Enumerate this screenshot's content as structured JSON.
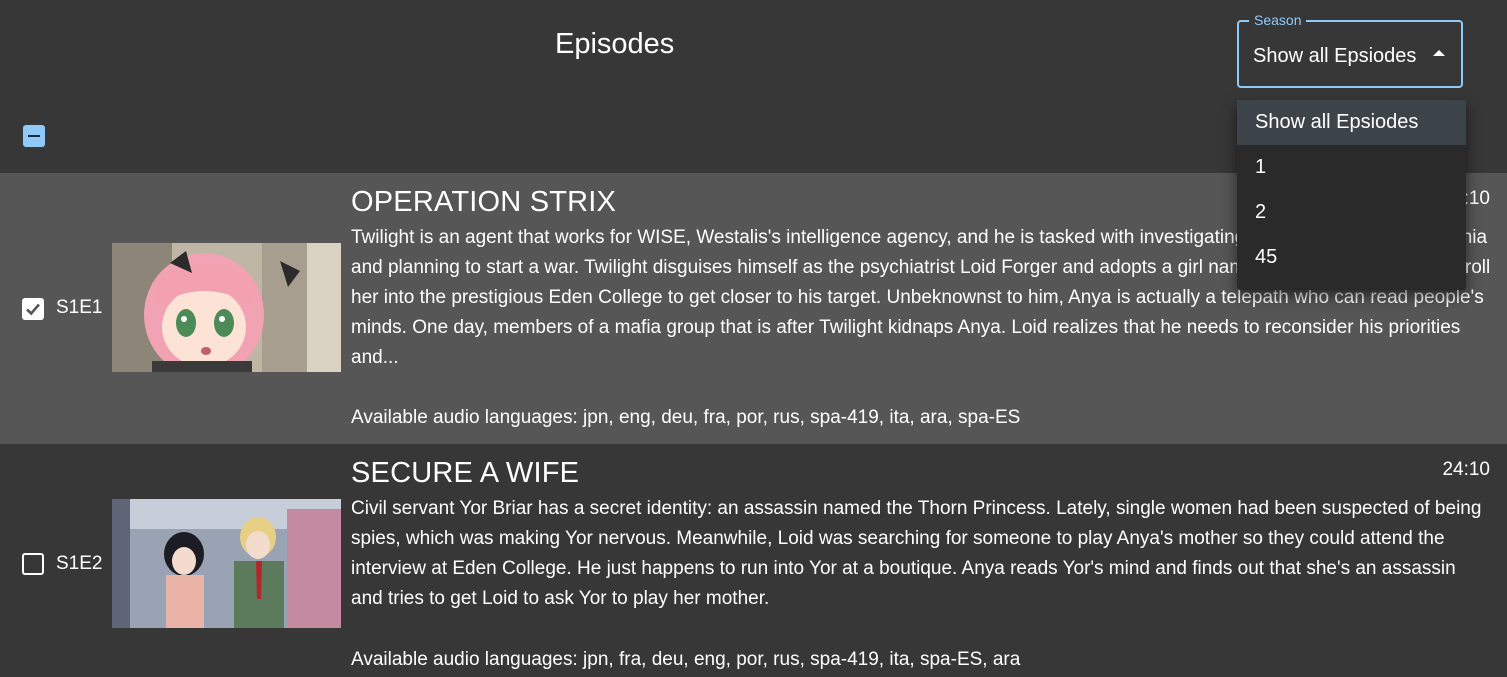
{
  "header": {
    "title": "Episodes"
  },
  "season": {
    "label": "Season",
    "selected": "Show all Epsiodes",
    "options": [
      "Show all Epsiodes",
      "1",
      "2",
      "45"
    ]
  },
  "colors": {
    "accent": "#90caf9",
    "row_selected_bg": "#565656",
    "page_bg": "#373737"
  },
  "episodes": [
    {
      "code": "S1E1",
      "checked": true,
      "title": "OPERATION STRIX",
      "duration": "24:10",
      "description": "Twilight is an agent that works for WISE, Westalis's intelligence agency, and he is tasked with investigating Desmond, who is in Ostania and planning to start a war. Twilight disguises himself as the psychiatrist Loid Forger and adopts a girl named Anya so that he can enroll her into the prestigious Eden College to get closer to his target. Unbeknownst to him, Anya is actually a telepath who can read people's minds. One day, members of a mafia group that is after Twilight kidnaps Anya. Loid realizes that he needs to reconsider his priorities and...",
      "audio": "Available audio languages: jpn, eng, deu, fra, por, rus, spa-419, ita, ara, spa-ES"
    },
    {
      "code": "S1E2",
      "checked": false,
      "title": "SECURE A WIFE",
      "duration": "24:10",
      "description": "Civil servant Yor Briar has a secret identity: an assassin named the Thorn Princess. Lately, single women had been suspected of being spies, which was making Yor nervous. Meanwhile, Loid was searching for someone to play Anya's mother so they could attend the interview at Eden College. He just happens to run into Yor at a boutique. Anya reads Yor's mind and finds out that she's an assassin and tries to get Loid to ask Yor to play her mother.",
      "audio": "Available audio languages: jpn, fra, deu, eng, por, rus, spa-419, ita, spa-ES, ara"
    }
  ]
}
